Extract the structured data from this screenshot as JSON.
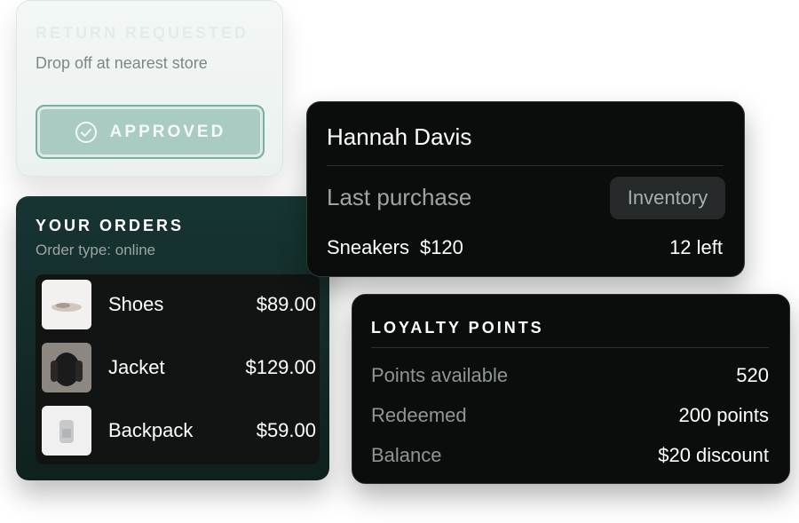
{
  "return_card": {
    "title": "RETURN REQUESTED",
    "subtitle": "Drop off at nearest store",
    "button_label": "APPROVED"
  },
  "orders": {
    "title": "YOUR ORDERS",
    "subtitle": "Order type: online",
    "items": [
      {
        "name": "Shoes",
        "price": "$89.00",
        "thumb": "shoes-thumbnail"
      },
      {
        "name": "Jacket",
        "price": "$129.00",
        "thumb": "jacket-thumbnail"
      },
      {
        "name": "Backpack",
        "price": "$59.00",
        "thumb": "backpack-thumbnail"
      }
    ]
  },
  "customer": {
    "name": "Hannah Davis",
    "last_purchase_label": "Last purchase",
    "inventory_label": "Inventory",
    "item": "Sneakers",
    "price": "$120",
    "stock": "12 left"
  },
  "loyalty": {
    "title": "LOYALTY POINTS",
    "rows": [
      {
        "label": "Points available",
        "value": "520"
      },
      {
        "label": "Redeemed",
        "value": "200 points"
      },
      {
        "label": "Balance",
        "value": "$20 discount"
      }
    ]
  },
  "colors": {
    "accent_teal": "#79afa3",
    "dark_teal": "#173533",
    "card_dark": "#0b0d0d"
  }
}
